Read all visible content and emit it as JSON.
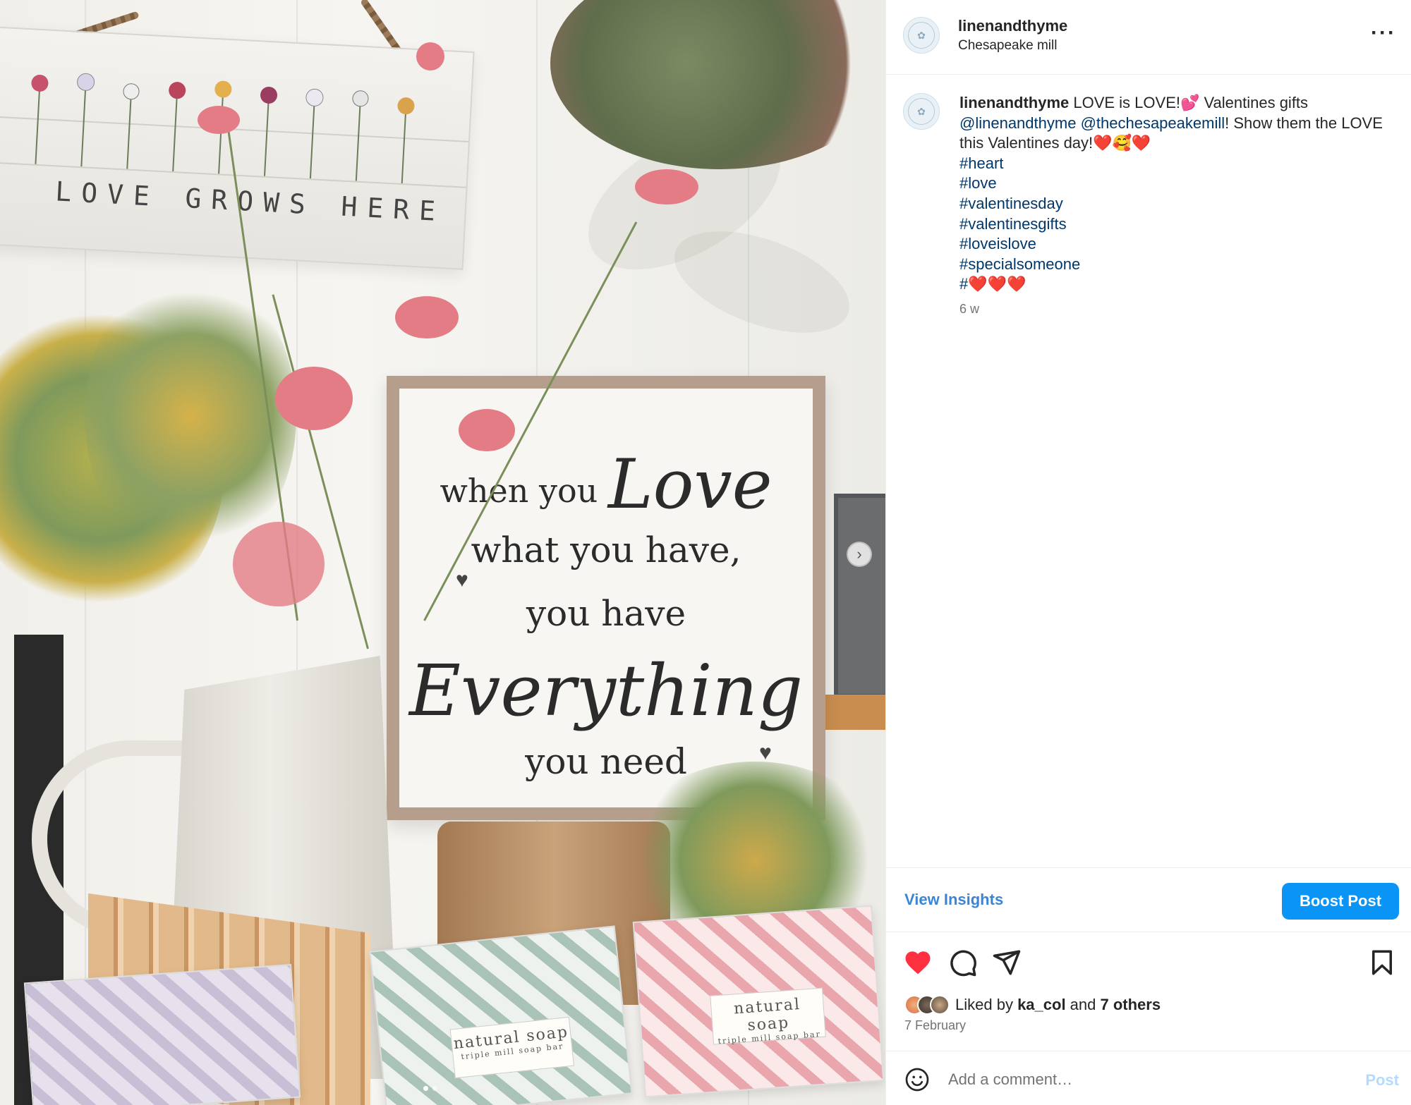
{
  "photo": {
    "sign_top_text": "LOVE GROWS HERE",
    "quote": {
      "line1_prefix": "when you",
      "line1_script": "Love",
      "line2": "what you have,",
      "line3": "you have",
      "line4": "Everything",
      "line5": "you need"
    },
    "soap_label_1": "natural soap",
    "soap_label_1_sub": "triple mill soap bar",
    "soap_label_2": "natural soap",
    "soap_label_2_sub": "triple mill soap bar",
    "next_icon": "chevron-right-icon"
  },
  "header": {
    "username": "linenandthyme",
    "location": "Chesapeake mill",
    "more_icon": "ellipsis-icon",
    "more_label": "···"
  },
  "caption": {
    "username": "linenandthyme",
    "text_1": " LOVE is LOVE!💕  Valentines gifts",
    "mention_1": "@linenandthyme",
    "mention_2": "@thechesapeakemill",
    "text_2": "! Show them the LOVE this Valentines day!❤️🥰❤️",
    "hashtags": [
      "#heart",
      "#love",
      "#valentinesday",
      "#valentinesgifts",
      "#loveislove",
      "#specialsomeone",
      "#❤️❤️❤️"
    ],
    "time": "6 w"
  },
  "insights": {
    "view_label": "View Insights",
    "boost_label": "Boost Post"
  },
  "actions": {
    "like_icon": "heart-filled-icon",
    "comment_icon": "comment-icon",
    "share_icon": "send-icon",
    "save_icon": "bookmark-icon",
    "like_color": "#ff3040"
  },
  "likes": {
    "prefix": "Liked by ",
    "user": "ka_col",
    "middle": " and ",
    "others": "7 others",
    "date": "7 February"
  },
  "comment": {
    "placeholder": "Add a comment…",
    "post_label": "Post",
    "emoji_icon": "emoji-smile-icon"
  }
}
